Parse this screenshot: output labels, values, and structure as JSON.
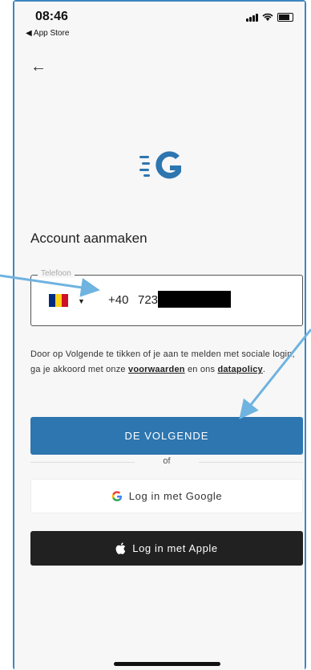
{
  "status": {
    "time": "08:46",
    "back_app": "◀ App Store"
  },
  "nav": {
    "back_icon": "←"
  },
  "page": {
    "title": "Account aanmaken"
  },
  "phone_field": {
    "label": "Telefoon",
    "country_code": "+40",
    "number_visible": "723",
    "flag_colors": [
      "#002b7f",
      "#fcd116",
      "#ce1126"
    ]
  },
  "terms": {
    "text_before": "Door op Volgende te tikken of je aan te melden met sociale login, ga je akkoord met onze ",
    "link_terms": "voorwaarden",
    "text_middle": " en ons ",
    "link_privacy": "datapolicy",
    "text_after": "."
  },
  "buttons": {
    "next": "DE VOLGENDE",
    "divider": "of",
    "google": "Log in met Google",
    "apple": "Log in met Apple"
  },
  "colors": {
    "primary": "#2d76b0",
    "annotation": "#6fb3e0",
    "apple_bg": "#212121"
  }
}
